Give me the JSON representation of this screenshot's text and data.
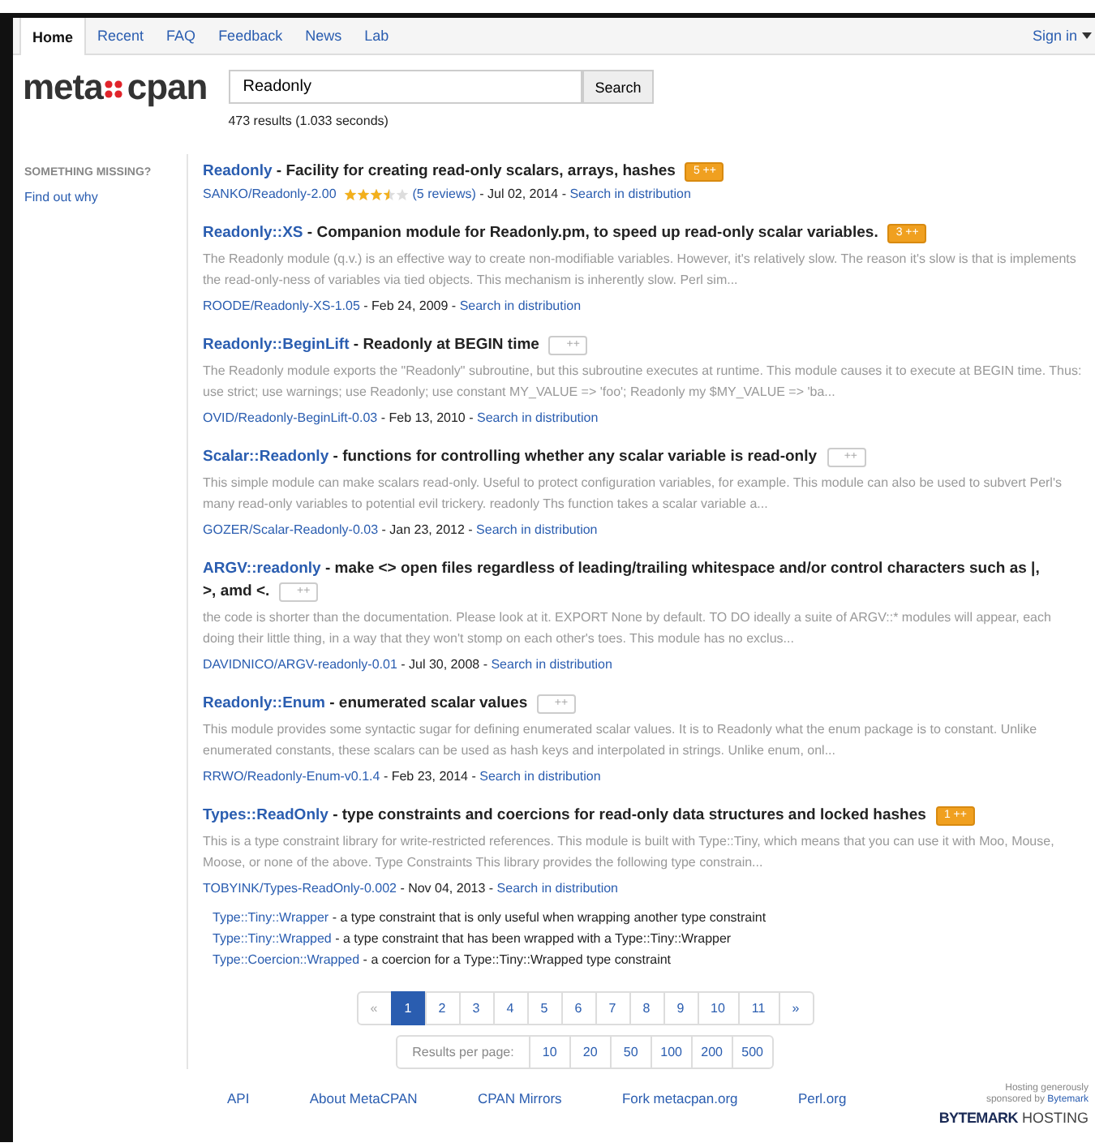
{
  "nav": {
    "tabs": [
      {
        "label": "Home",
        "selected": true
      },
      {
        "label": "Recent",
        "selected": false
      },
      {
        "label": "FAQ",
        "selected": false
      },
      {
        "label": "Feedback",
        "selected": false
      },
      {
        "label": "News",
        "selected": false
      },
      {
        "label": "Lab",
        "selected": false
      }
    ],
    "sign_in": "Sign in"
  },
  "logo": {
    "left": "meta",
    "right": "cpan"
  },
  "search": {
    "value": "Readonly",
    "button": "Search",
    "summary": "473 results (1.033 seconds)"
  },
  "sidebar": {
    "heading": "SOMETHING MISSING?",
    "link": "Find out why"
  },
  "results": [
    {
      "name": "Readonly",
      "abstract": " - Facility for creating read-only scalars, arrays, hashes",
      "plusplus": {
        "label": "5 ++",
        "on": true
      },
      "release": "SANKO/Readonly-2.00",
      "stars": 3.5,
      "reviews": "(5 reviews)",
      "date": " - Jul 02, 2014 - ",
      "dist": "Search in distribution"
    },
    {
      "name": "Readonly::XS",
      "abstract": " - Companion module for Readonly.pm, to speed up read-only scalar variables.",
      "plusplus": {
        "label": "3 ++",
        "on": true
      },
      "description": "The Readonly module (q.v.) is an effective way to create non-modifiable variables. However, it's relatively slow. The reason it's slow is that is implements the read-only-ness of variables via tied objects. This mechanism is inherently slow. Perl sim...",
      "release": "ROODE/Readonly-XS-1.05",
      "date": " - Feb 24, 2009 - ",
      "dist": "Search in distribution"
    },
    {
      "name": "Readonly::BeginLift",
      "abstract": " - Readonly at BEGIN time",
      "plusplus": {
        "label": "++",
        "on": false
      },
      "description": "The Readonly module exports the \"Readonly\" subroutine, but this subroutine executes at runtime. This module causes it to execute at BEGIN time. Thus: use strict; use warnings; use Readonly; use constant MY_VALUE => 'foo'; Readonly my $MY_VALUE => 'ba...",
      "release": "OVID/Readonly-BeginLift-0.03",
      "date": " - Feb 13, 2010 - ",
      "dist": "Search in distribution"
    },
    {
      "name": "Scalar::Readonly",
      "abstract": " - functions for controlling whether any scalar variable is read-only",
      "plusplus": {
        "label": "++",
        "on": false
      },
      "description": "This simple module can make scalars read-only. Useful to protect configuration variables, for example. This module can also be used to subvert Perl's many read-only variables to potential evil trickery. readonly Ths function takes a scalar variable a...",
      "release": "GOZER/Scalar-Readonly-0.03",
      "date": " - Jan 23, 2012 - ",
      "dist": "Search in distribution"
    },
    {
      "name": "ARGV::readonly",
      "abstract": " - make <> open files regardless of leading/trailing whitespace and/or control characters such as |,",
      "abstract_wrap": ">, amd <.",
      "plusplus": {
        "label": "++",
        "on": false
      },
      "description": "the code is shorter than the documentation. Please look at it. EXPORT None by default. TO DO ideally a suite of ARGV::* modules will appear, each doing their little thing, in a way that they won't stomp on each other's toes. This module has no exclus...",
      "release": "DAVIDNICO/ARGV-readonly-0.01",
      "date": " - Jul 30, 2008 - ",
      "dist": "Search in distribution"
    },
    {
      "name": "Readonly::Enum",
      "abstract": " - enumerated scalar values",
      "plusplus": {
        "label": "++",
        "on": false
      },
      "description": "This module provides some syntactic sugar for defining enumerated scalar values. It is to Readonly what the enum package is to constant. Unlike enumerated constants, these scalars can be used as hash keys and interpolated in strings. Unlike enum, onl...",
      "release": "RRWO/Readonly-Enum-v0.1.4",
      "date": " - Feb 23, 2014 - ",
      "dist": "Search in distribution"
    },
    {
      "name": "Types::ReadOnly",
      "abstract": " - type constraints and coercions for read-only data structures and locked hashes",
      "plusplus": {
        "label": "1 ++",
        "on": true
      },
      "description": "This is a type constraint library for write-restricted references. This module is built with Type::Tiny, which means that you can use it with Moo, Mouse, Moose, or none of the above. Type Constraints This library provides the following type constrain...",
      "release": "TOBYINK/Types-ReadOnly-0.002",
      "date": " - Nov 04, 2013 - ",
      "dist": "Search in distribution",
      "modules": [
        {
          "name": "Type::Tiny::Wrapper",
          "text": " - a type constraint that is only useful when wrapping another type constraint"
        },
        {
          "name": "Type::Tiny::Wrapped",
          "text": " - a type constraint that has been wrapped with a Type::Tiny::Wrapper"
        },
        {
          "name": "Type::Coercion::Wrapped",
          "text": " - a coercion for a Type::Tiny::Wrapped type constraint"
        }
      ]
    }
  ],
  "pagination": {
    "prev": "«",
    "pages": [
      {
        "label": "1",
        "selected": true
      },
      {
        "label": "2",
        "selected": false
      },
      {
        "label": "3",
        "selected": false
      },
      {
        "label": "4",
        "selected": false
      },
      {
        "label": "5",
        "selected": false
      },
      {
        "label": "6",
        "selected": false
      },
      {
        "label": "7",
        "selected": false
      },
      {
        "label": "8",
        "selected": false
      },
      {
        "label": "9",
        "selected": false
      },
      {
        "label": "10",
        "selected": false
      },
      {
        "label": "11",
        "selected": false
      }
    ],
    "next": "»"
  },
  "per_page": {
    "label": "Results per page:",
    "options": [
      "10",
      "20",
      "50",
      "100",
      "200",
      "500"
    ]
  },
  "footer": {
    "links": [
      "API",
      "About MetaCPAN",
      "CPAN Mirrors",
      "Fork metacpan.org",
      "Perl.org"
    ],
    "sponsor_text": "Hosting generously sponsored by",
    "sponsor_link": "Bytemark",
    "sponsor_logo_bold": "BYTEMARK",
    "sponsor_logo_light": "HOSTING"
  }
}
